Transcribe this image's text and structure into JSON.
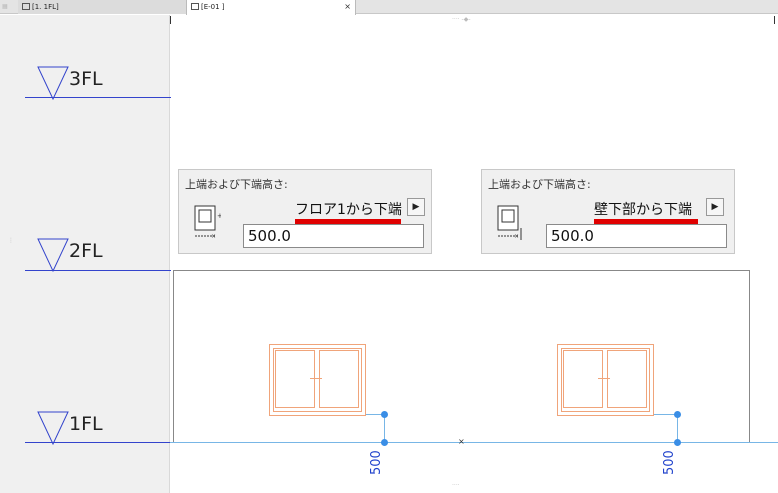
{
  "tabs": [
    {
      "label": "[1. 1FL]",
      "icon": "plan-icon"
    },
    {
      "label": "[E-01 ]",
      "icon": "elevation-icon",
      "close": "×"
    }
  ],
  "levels": [
    {
      "label": "3FL"
    },
    {
      "label": "2FL"
    },
    {
      "label": "1FL"
    }
  ],
  "panels": [
    {
      "title": "上端および下端高さ:",
      "selection": "フロア1から下端",
      "value": "500.0",
      "arrow": "▶"
    },
    {
      "title": "上端および下端高さ:",
      "selection": "壁下部から下端",
      "value": "500.0",
      "arrow": "▶"
    }
  ],
  "dimensions": [
    {
      "value": "500"
    },
    {
      "value": "500"
    }
  ],
  "colors": {
    "level_line": "#3344cc",
    "window": "#f0a47a",
    "grid": "#78b6e6",
    "dimension_text": "#2244cc",
    "highlight": "#e00000"
  }
}
